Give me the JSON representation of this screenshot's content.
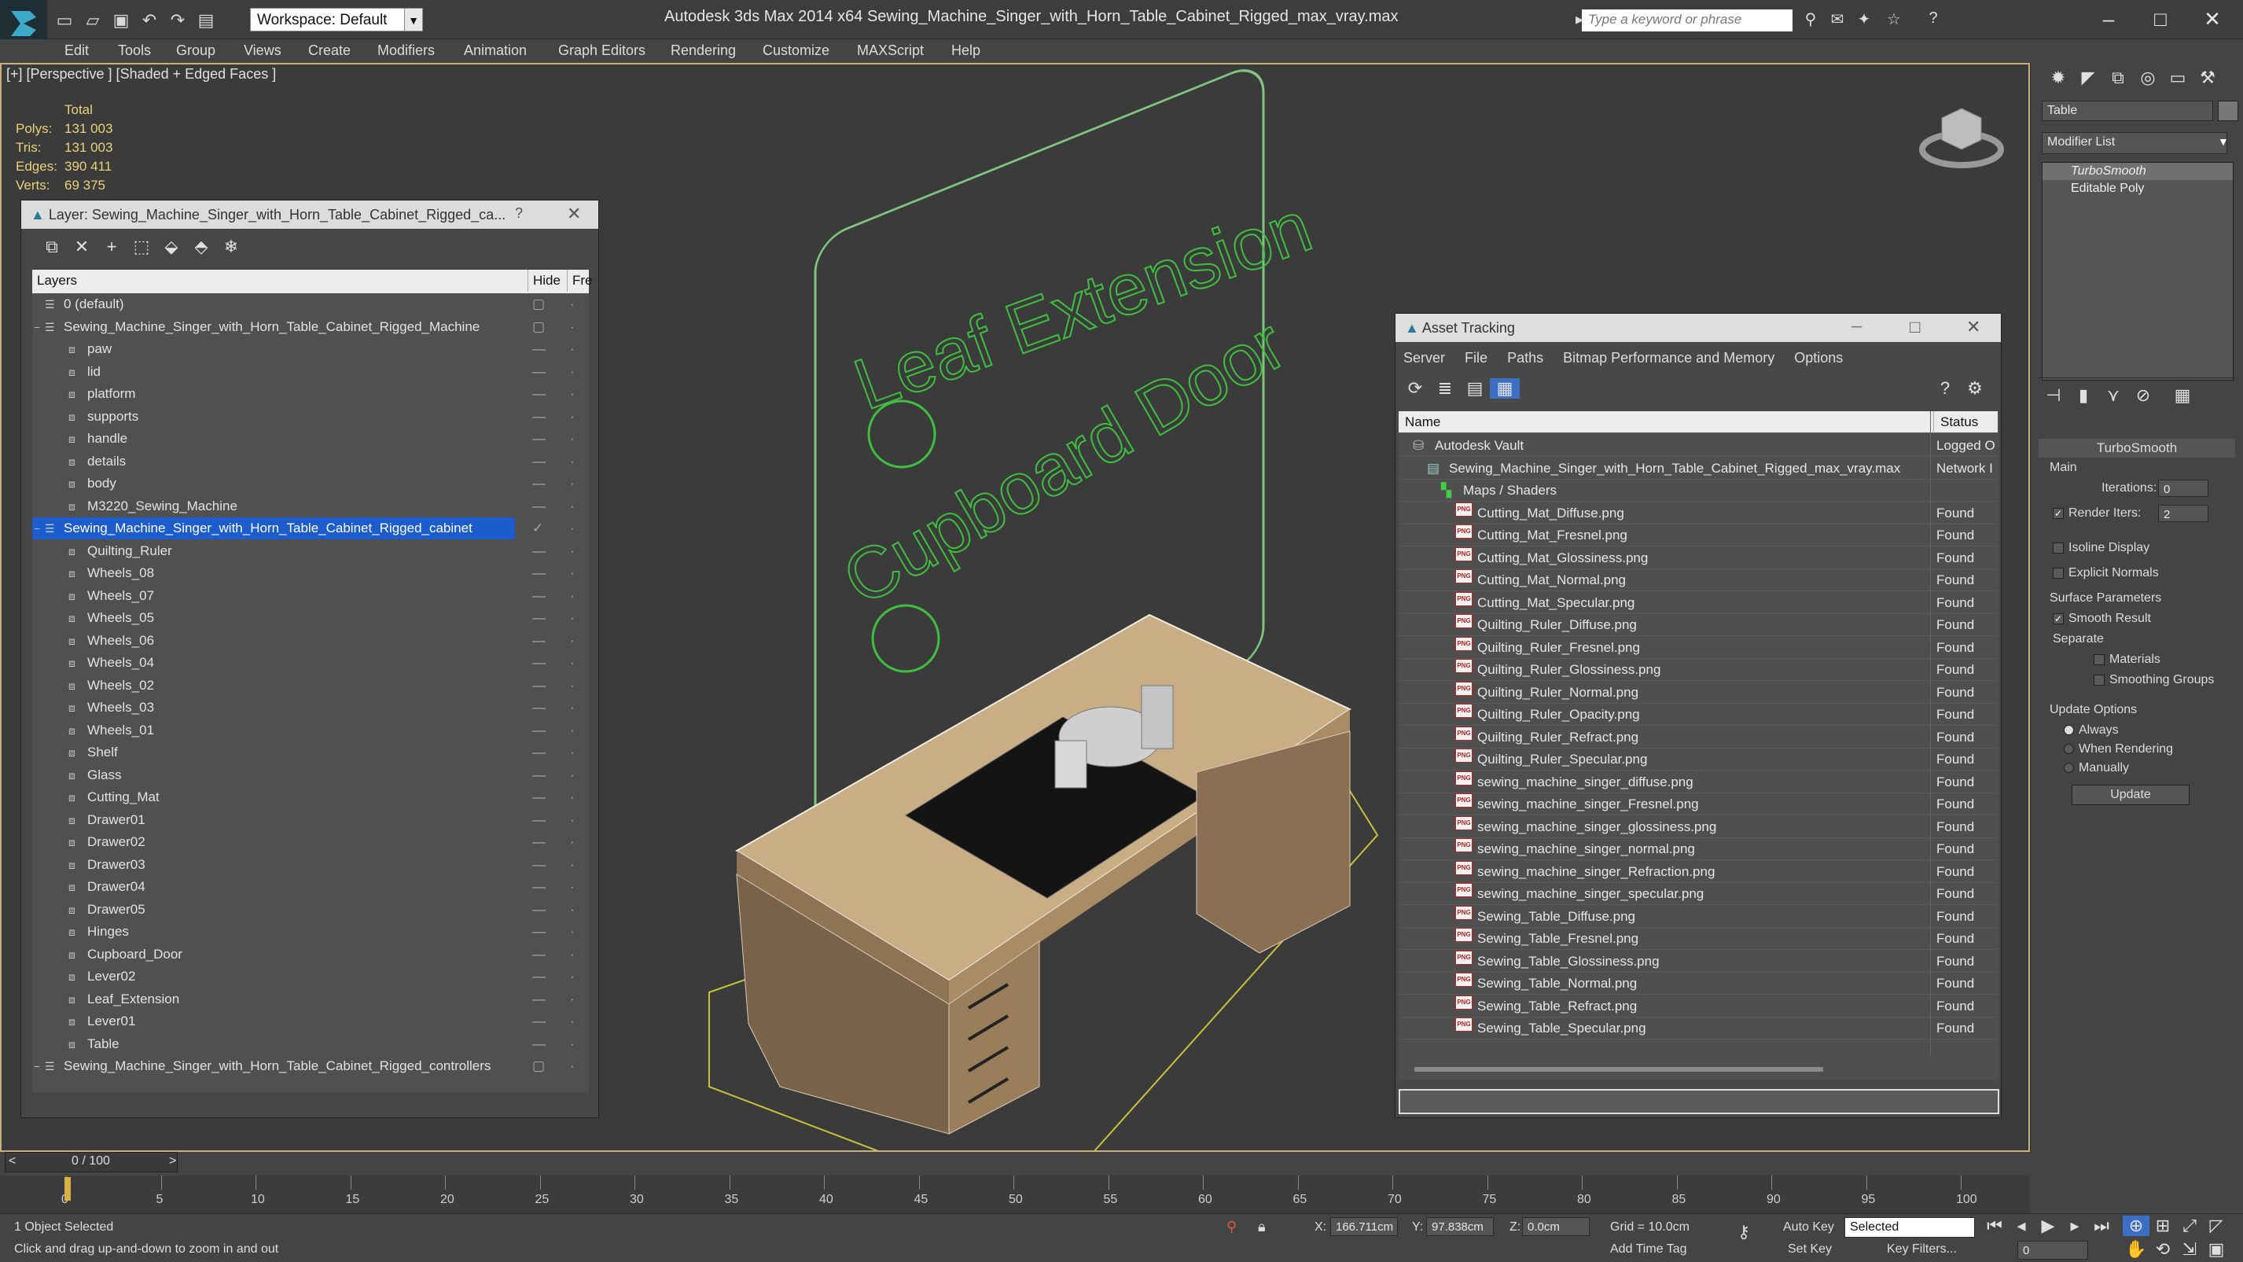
{
  "app": {
    "workspace": "Workspace: Default",
    "title": "Autodesk 3ds Max  2014 x64      Sewing_Machine_Singer_with_Horn_Table_Cabinet_Rigged_max_vray.max",
    "search_placeholder": "Type a keyword or phrase"
  },
  "menu": [
    "Edit",
    "Tools",
    "Group",
    "Views",
    "Create",
    "Modifiers",
    "Animation",
    "Graph Editors",
    "Rendering",
    "Customize",
    "MAXScript",
    "Help"
  ],
  "viewport": {
    "label": "[+] [Perspective ] [Shaded + Edged Faces ]",
    "stats": {
      "header": "Total",
      "rows": [
        [
          "Polys:",
          "131 003"
        ],
        [
          "Tris:",
          "131 003"
        ],
        [
          "Edges:",
          "390 411"
        ],
        [
          "Verts:",
          "69 375"
        ]
      ]
    },
    "sign1": "Leaf Extension",
    "sign2": "Cupboard Door"
  },
  "layers": {
    "title": "Layer: Sewing_Machine_Singer_with_Horn_Table_Cabinet_Rigged_ca...",
    "help": "?",
    "col_layers": "Layers",
    "col_hide": "Hide",
    "col_freeze": "Fre",
    "items": [
      {
        "label": "0 (default)",
        "level": 0
      },
      {
        "label": "Sewing_Machine_Singer_with_Horn_Table_Cabinet_Rigged_Machine",
        "level": 0
      },
      {
        "label": "paw",
        "level": 1
      },
      {
        "label": "lid",
        "level": 1
      },
      {
        "label": "platform",
        "level": 1
      },
      {
        "label": "supports",
        "level": 1
      },
      {
        "label": "handle",
        "level": 1
      },
      {
        "label": "details",
        "level": 1
      },
      {
        "label": "body",
        "level": 1
      },
      {
        "label": "M3220_Sewing_Machine",
        "level": 1
      },
      {
        "label": "Sewing_Machine_Singer_with_Horn_Table_Cabinet_Rigged_cabinet",
        "level": 0,
        "selected": true
      },
      {
        "label": "Quilting_Ruler",
        "level": 1
      },
      {
        "label": "Wheels_08",
        "level": 1
      },
      {
        "label": "Wheels_07",
        "level": 1
      },
      {
        "label": "Wheels_05",
        "level": 1
      },
      {
        "label": "Wheels_06",
        "level": 1
      },
      {
        "label": "Wheels_04",
        "level": 1
      },
      {
        "label": "Wheels_02",
        "level": 1
      },
      {
        "label": "Wheels_03",
        "level": 1
      },
      {
        "label": "Wheels_01",
        "level": 1
      },
      {
        "label": "Shelf",
        "level": 1
      },
      {
        "label": "Glass",
        "level": 1
      },
      {
        "label": "Cutting_Mat",
        "level": 1
      },
      {
        "label": "Drawer01",
        "level": 1
      },
      {
        "label": "Drawer02",
        "level": 1
      },
      {
        "label": "Drawer03",
        "level": 1
      },
      {
        "label": "Drawer04",
        "level": 1
      },
      {
        "label": "Drawer05",
        "level": 1
      },
      {
        "label": "Hinges",
        "level": 1
      },
      {
        "label": "Cupboard_Door",
        "level": 1
      },
      {
        "label": "Lever02",
        "level": 1
      },
      {
        "label": "Leaf_Extension",
        "level": 1
      },
      {
        "label": "Lever01",
        "level": 1
      },
      {
        "label": "Table",
        "level": 1
      },
      {
        "label": "Sewing_Machine_Singer_with_Horn_Table_Cabinet_Rigged_controllers",
        "level": 0
      }
    ]
  },
  "assets": {
    "title": "Asset Tracking",
    "menu": [
      "Server",
      "File",
      "Paths",
      "Bitmap Performance and Memory",
      "Options"
    ],
    "col_name": "Name",
    "col_status": "Status",
    "rows": [
      {
        "name": "Autodesk Vault",
        "status": "Logged O",
        "indent": 1,
        "icon": "vault"
      },
      {
        "name": "Sewing_Machine_Singer_with_Horn_Table_Cabinet_Rigged_max_vray.max",
        "status": "Network I",
        "indent": 2,
        "icon": "max"
      },
      {
        "name": "Maps / Shaders",
        "status": "",
        "indent": 3,
        "icon": "maps"
      },
      {
        "name": "Cutting_Mat_Diffuse.png",
        "status": "Found",
        "indent": 4,
        "icon": "png"
      },
      {
        "name": "Cutting_Mat_Fresnel.png",
        "status": "Found",
        "indent": 4,
        "icon": "png"
      },
      {
        "name": "Cutting_Mat_Glossiness.png",
        "status": "Found",
        "indent": 4,
        "icon": "png"
      },
      {
        "name": "Cutting_Mat_Normal.png",
        "status": "Found",
        "indent": 4,
        "icon": "png"
      },
      {
        "name": "Cutting_Mat_Specular.png",
        "status": "Found",
        "indent": 4,
        "icon": "png"
      },
      {
        "name": "Quilting_Ruler_Diffuse.png",
        "status": "Found",
        "indent": 4,
        "icon": "png"
      },
      {
        "name": "Quilting_Ruler_Fresnel.png",
        "status": "Found",
        "indent": 4,
        "icon": "png"
      },
      {
        "name": "Quilting_Ruler_Glossiness.png",
        "status": "Found",
        "indent": 4,
        "icon": "png"
      },
      {
        "name": "Quilting_Ruler_Normal.png",
        "status": "Found",
        "indent": 4,
        "icon": "png"
      },
      {
        "name": "Quilting_Ruler_Opacity.png",
        "status": "Found",
        "indent": 4,
        "icon": "png"
      },
      {
        "name": "Quilting_Ruler_Refract.png",
        "status": "Found",
        "indent": 4,
        "icon": "png"
      },
      {
        "name": "Quilting_Ruler_Specular.png",
        "status": "Found",
        "indent": 4,
        "icon": "png"
      },
      {
        "name": "sewing_machine_singer_diffuse.png",
        "status": "Found",
        "indent": 4,
        "icon": "png"
      },
      {
        "name": "sewing_machine_singer_Fresnel.png",
        "status": "Found",
        "indent": 4,
        "icon": "png"
      },
      {
        "name": "sewing_machine_singer_glossiness.png",
        "status": "Found",
        "indent": 4,
        "icon": "png"
      },
      {
        "name": "sewing_machine_singer_normal.png",
        "status": "Found",
        "indent": 4,
        "icon": "png"
      },
      {
        "name": "sewing_machine_singer_Refraction.png",
        "status": "Found",
        "indent": 4,
        "icon": "png"
      },
      {
        "name": "sewing_machine_singer_specular.png",
        "status": "Found",
        "indent": 4,
        "icon": "png"
      },
      {
        "name": "Sewing_Table_Diffuse.png",
        "status": "Found",
        "indent": 4,
        "icon": "png"
      },
      {
        "name": "Sewing_Table_Fresnel.png",
        "status": "Found",
        "indent": 4,
        "icon": "png"
      },
      {
        "name": "Sewing_Table_Glossiness.png",
        "status": "Found",
        "indent": 4,
        "icon": "png"
      },
      {
        "name": "Sewing_Table_Normal.png",
        "status": "Found",
        "indent": 4,
        "icon": "png"
      },
      {
        "name": "Sewing_Table_Refract.png",
        "status": "Found",
        "indent": 4,
        "icon": "png"
      },
      {
        "name": "Sewing_Table_Specular.png",
        "status": "Found",
        "indent": 4,
        "icon": "png"
      }
    ]
  },
  "cmd": {
    "object_name": "Table",
    "modifier_list": "Modifier List",
    "stack": [
      "TurboSmooth",
      "Editable Poly"
    ],
    "rollout": "TurboSmooth",
    "main": "Main",
    "iterations_label": "Iterations:",
    "iterations": "0",
    "render_iters_label": "Render Iters:",
    "render_iters": "2",
    "isoline": "Isoline Display",
    "explicit": "Explicit Normals",
    "surface": "Surface Parameters",
    "smooth_result": "Smooth Result",
    "separate": "Separate",
    "materials": "Materials",
    "smoothing_groups": "Smoothing Groups",
    "update_options": "Update Options",
    "always": "Always",
    "when_rendering": "When Rendering",
    "manually": "Manually",
    "update_btn": "Update"
  },
  "timeline": {
    "frame": "0 / 100",
    "ticks": [
      "0",
      "5",
      "10",
      "15",
      "20",
      "25",
      "30",
      "35",
      "40",
      "45",
      "50",
      "55",
      "60",
      "65",
      "70",
      "75",
      "80",
      "85",
      "90",
      "95",
      "100"
    ]
  },
  "status": {
    "selected": "1 Object Selected",
    "prompt": "Click and drag up-and-down to zoom in and out",
    "x": "166.711cm",
    "y": "97.838cm",
    "z": "0.0cm",
    "grid": "Grid = 10.0cm",
    "add_time_tag": "Add Time Tag",
    "auto_key": "Auto Key",
    "set_key": "Set Key",
    "selected_dd": "Selected",
    "key_filters": "Key Filters...",
    "frame_field": "0"
  }
}
